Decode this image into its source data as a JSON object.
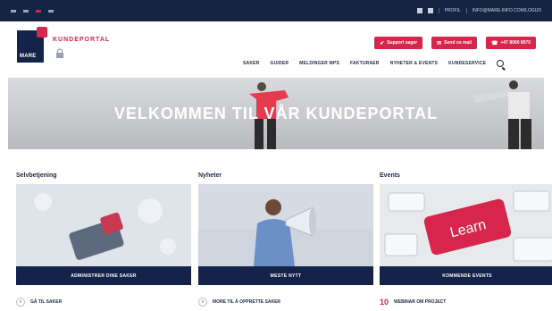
{
  "header": {
    "logo_text": "MARE",
    "brand": "KUNDEPORTAL"
  },
  "topbar": {
    "link": "PROFIL",
    "email": "INFO@MARE-INFO.COM/LOGUD"
  },
  "actions": [
    {
      "label": "Support sager",
      "icon": "check-icon"
    },
    {
      "label": "Send os mail",
      "icon": "mail-icon"
    },
    {
      "label": "+47 8000 8070",
      "icon": "phone-icon"
    }
  ],
  "nav": [
    {
      "label": "SAKER"
    },
    {
      "label": "GUIDER"
    },
    {
      "label": "MELDINGER MPS"
    },
    {
      "label": "FAKTURAER"
    },
    {
      "label": "NYHETER & EVENTS"
    },
    {
      "label": "KUNDESERVICE"
    }
  ],
  "hero": {
    "title": "VELKOMMEN TIL VÅR KUNDEPORTAL"
  },
  "columns": [
    {
      "title": "Selvbetjening",
      "button": "ADMINISTRER DINE SAKER",
      "link": "GÅ TIL SAKER",
      "link_icon": "arrow-icon"
    },
    {
      "title": "Nyheter",
      "button": "MESTE NYTT",
      "link": "MORE TIL Å OPPRETTE SAKER",
      "link_icon": "arrow-icon"
    },
    {
      "title": "Events",
      "button": "KOMMENDE EVENTS",
      "link": "WEBINAR OM PROJECT",
      "link_number": "10"
    }
  ],
  "colors": {
    "navy": "#142443",
    "accent": "#d7264c"
  }
}
